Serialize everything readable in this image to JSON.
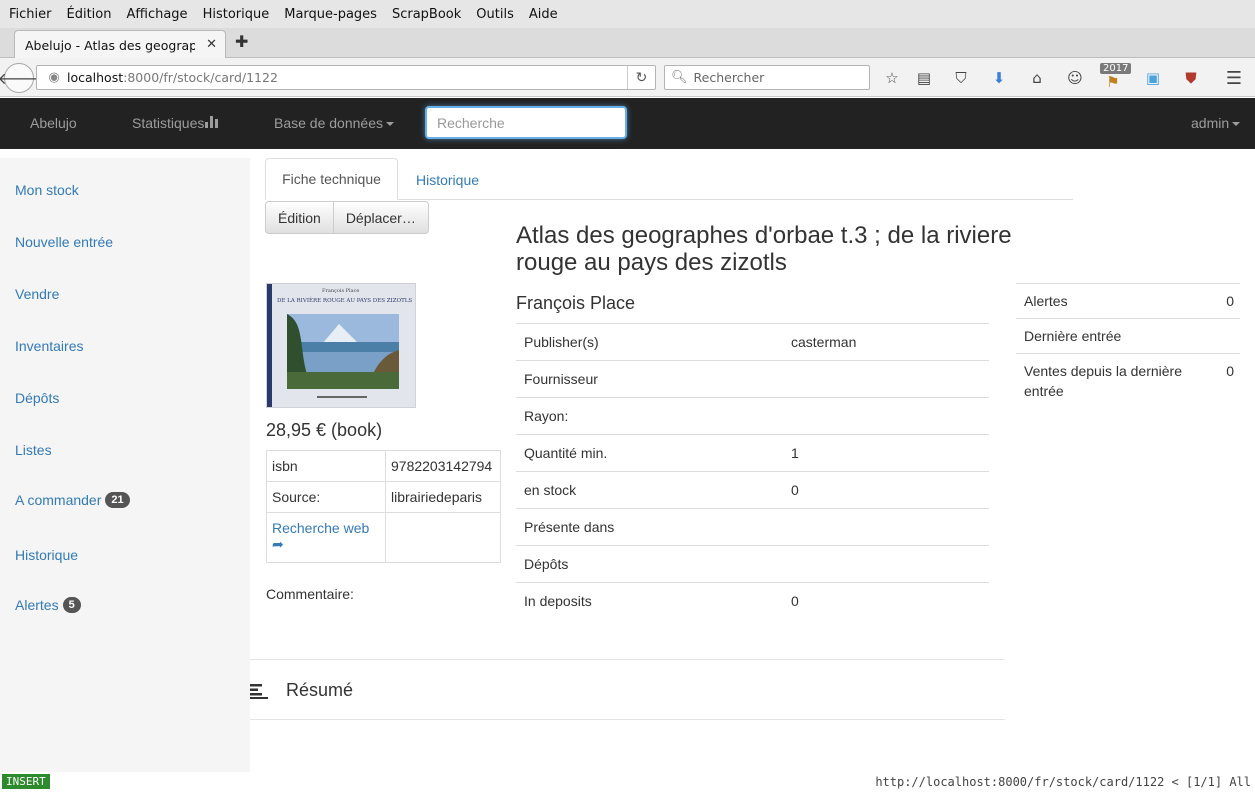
{
  "browser": {
    "menu": [
      "Fichier",
      "Édition",
      "Affichage",
      "Historique",
      "Marque-pages",
      "ScrapBook",
      "Outils",
      "Aide"
    ],
    "tab_title": "Abelujo - Atlas des geograph…",
    "url_host": "localhost",
    "url_path": ":8000/fr/stock/card/1122",
    "search_placeholder": "Rechercher",
    "badge_year": "2017"
  },
  "appnav": {
    "brand": "Abelujo",
    "stats": "Statistiques",
    "database": "Base de données",
    "search_placeholder": "Recherche",
    "user": "admin"
  },
  "sidebar": {
    "items": [
      {
        "label": "Mon stock"
      },
      {
        "label": "Nouvelle entrée"
      },
      {
        "label": "Vendre"
      },
      {
        "label": "Inventaires"
      },
      {
        "label": "Dépôts"
      },
      {
        "label": "Listes"
      },
      {
        "label": "A commander",
        "badge": "21"
      },
      {
        "label": "Historique"
      },
      {
        "label": "Alertes",
        "badge": "5"
      }
    ]
  },
  "card": {
    "tabs": {
      "active": "Fiche technique",
      "other": "Historique"
    },
    "buttons": {
      "edit": "Édition",
      "move": "Déplacer…"
    },
    "cover_title": "DE LA RIVIÈRE ROUGE AU PAYS DES ZIZOTLS",
    "cover_author": "François Place",
    "price": "28,95 € (book)",
    "isbn_label": "isbn",
    "isbn": "9782203142794",
    "source_label": "Source:",
    "source": "librairiedeparis",
    "web_search": "Recherche web",
    "comment_label": "Commentaire:",
    "title": "Atlas des geographes d'orbae t.3 ; de la riviere rouge au pays des zizotls",
    "author": "François Place",
    "details": [
      {
        "key": "Publisher(s)",
        "value": "casterman",
        "link": true
      },
      {
        "key": "Fournisseur",
        "value": ""
      },
      {
        "key": "Rayon:",
        "value": ""
      },
      {
        "key": "Quantité min.",
        "value": "1"
      },
      {
        "key": "en stock",
        "value": "0"
      },
      {
        "key": "Présente dans",
        "value": ""
      },
      {
        "key": "Dépôts",
        "value": ""
      },
      {
        "key": "In deposits",
        "value": "0"
      }
    ],
    "alerts": [
      {
        "key": "Alertes",
        "value": "0"
      },
      {
        "key": "Dernière entrée",
        "value": ""
      },
      {
        "key": "Ventes depuis la dernière entrée",
        "value": "0"
      }
    ],
    "resume": "Résumé"
  },
  "status": {
    "mode": "INSERT",
    "url": "http://localhost:8000/fr/stock/card/1122 < [1/1] All"
  }
}
